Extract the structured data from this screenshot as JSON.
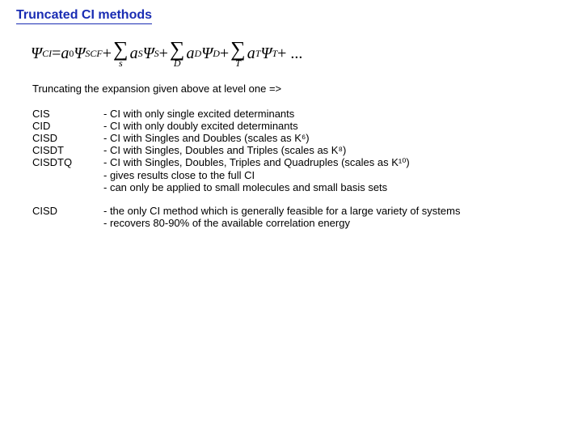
{
  "title": "Truncated CI methods",
  "equation": {
    "psi_ci": "Ψ",
    "ci_sub": "CI",
    "eq": " = ",
    "a0": "a",
    "zero": "0",
    "psi_scf": "Ψ",
    "scf_sub": "SCF",
    "plus": " + ",
    "sum_s_under": "s",
    "a_s": "a",
    "s_sub": "S",
    "psi_s": "Ψ",
    "psiS_sub": "S",
    "sum_d_under": "D",
    "a_d": "a",
    "d_sub": "D",
    "psi_d": "Ψ",
    "psiD_sub": "D",
    "sum_t_under": "T",
    "a_t": "a",
    "t_sub": "T",
    "psi_t": "Ψ",
    "psiT_sub": "T",
    "trail": " + ..."
  },
  "intro": "Truncating the expansion given above at level one =>",
  "rows": [
    {
      "label": "CIS",
      "lines": [
        "- CI with only single excited determinants"
      ]
    },
    {
      "label": "CID",
      "lines": [
        "- CI with only doubly excited determinants"
      ]
    },
    {
      "label": "CISD",
      "lines": [
        "- CI with Singles and Doubles (scales as K⁶)"
      ]
    },
    {
      "label": "CISDT",
      "lines": [
        "- CI with Singles, Doubles and Triples (scales as K⁸)"
      ]
    },
    {
      "label": "CISDTQ",
      "lines": [
        "- CI with Singles, Doubles, Triples and Quadruples (scales as K¹⁰)",
        "- gives results close to the full CI",
        "- can only be applied to small molecules and small basis sets"
      ]
    }
  ],
  "second": {
    "label": "CISD",
    "lines": [
      "- the only CI method which is generally feasible for a large variety of systems",
      "- recovers 80-90% of the available correlation energy"
    ]
  }
}
